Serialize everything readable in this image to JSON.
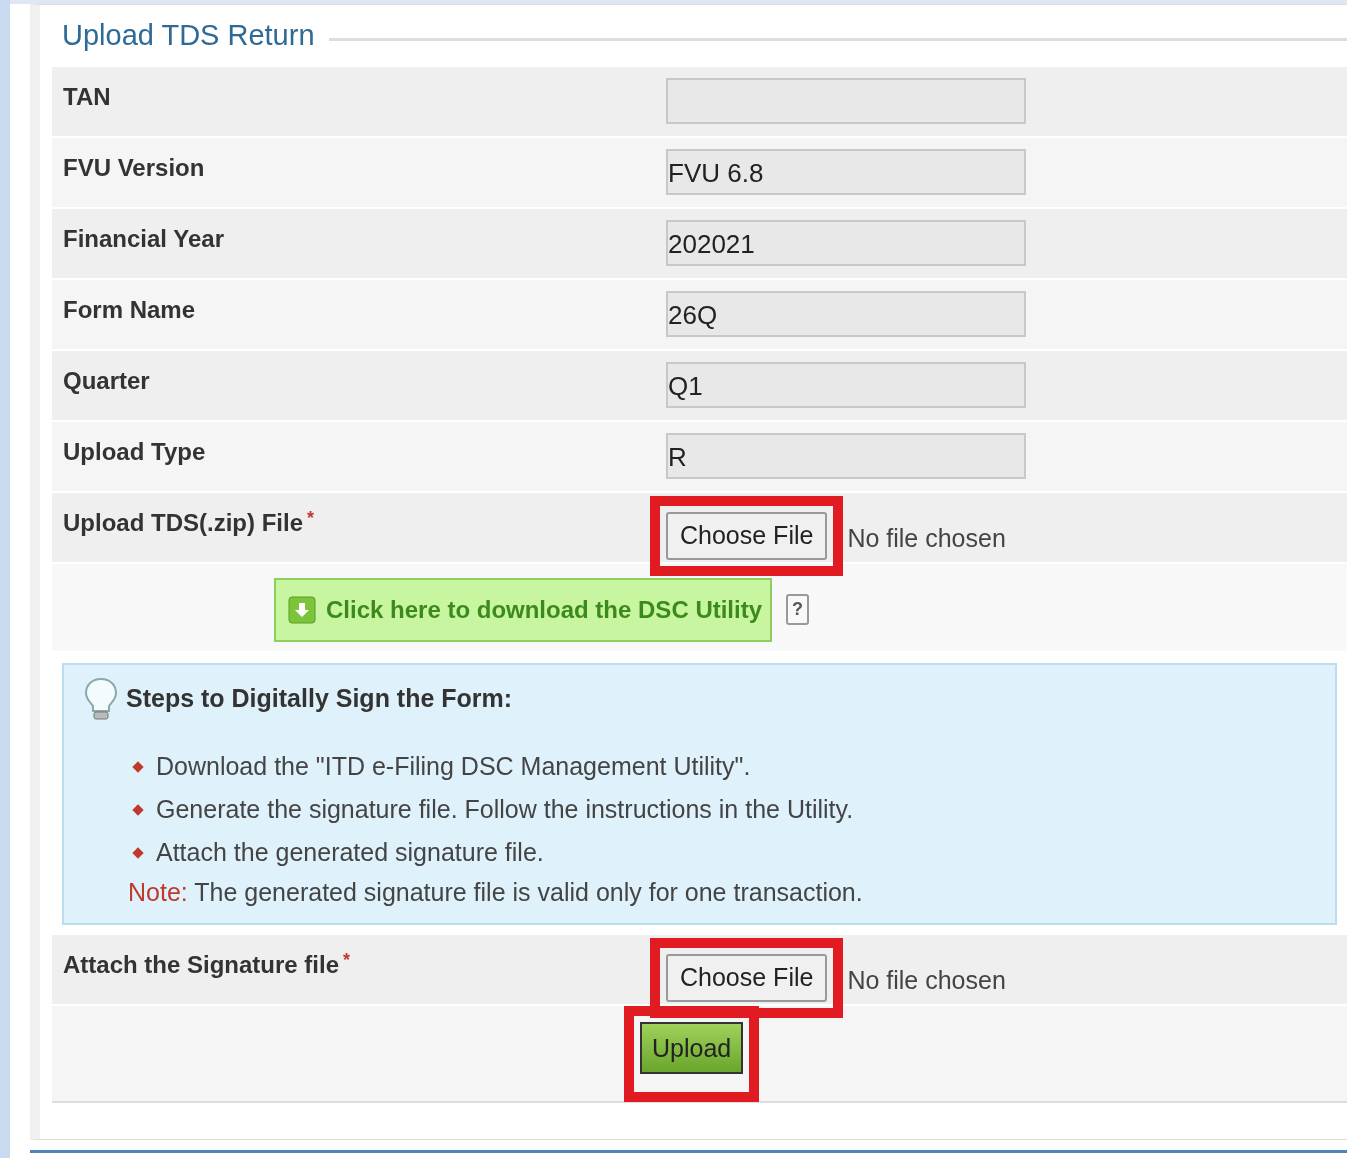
{
  "section_title": "Upload TDS Return",
  "fields": [
    {
      "label": "TAN",
      "kind": "text"
    },
    {
      "label": "FVU Version",
      "kind": "text",
      "value": "FVU 6.8"
    },
    {
      "label": "Financial Year",
      "kind": "text",
      "value": "202021"
    },
    {
      "label": "Form Name",
      "kind": "text",
      "value": "26Q"
    },
    {
      "label": "Quarter",
      "kind": "text",
      "value": "Q1"
    },
    {
      "label": "Upload Type",
      "kind": "text",
      "value": "R"
    },
    {
      "label": "Upload TDS(.zip) File",
      "kind": "file",
      "required_mark": "*",
      "button": "Choose File",
      "status": "No file chosen",
      "highlighted": true
    }
  ],
  "download_link": {
    "text": "Click here to download the DSC Utility",
    "help": "?"
  },
  "steps": {
    "title": "Steps to Digitally Sign the Form:",
    "items": [
      "Download the \"ITD e-Filing DSC Management Utility\".",
      "Generate the signature file. Follow the instructions in the Utility.",
      "Attach the generated signature file."
    ],
    "note_label": "Note:",
    "note_text": "The generated signature file is valid only for one transaction."
  },
  "signature": {
    "label": "Attach the Signature file",
    "kind": "file",
    "required_mark": "*",
    "button": "Choose File",
    "status": "No file chosen",
    "highlighted": true
  },
  "upload_button": {
    "label": "Upload",
    "highlighted": true
  }
}
